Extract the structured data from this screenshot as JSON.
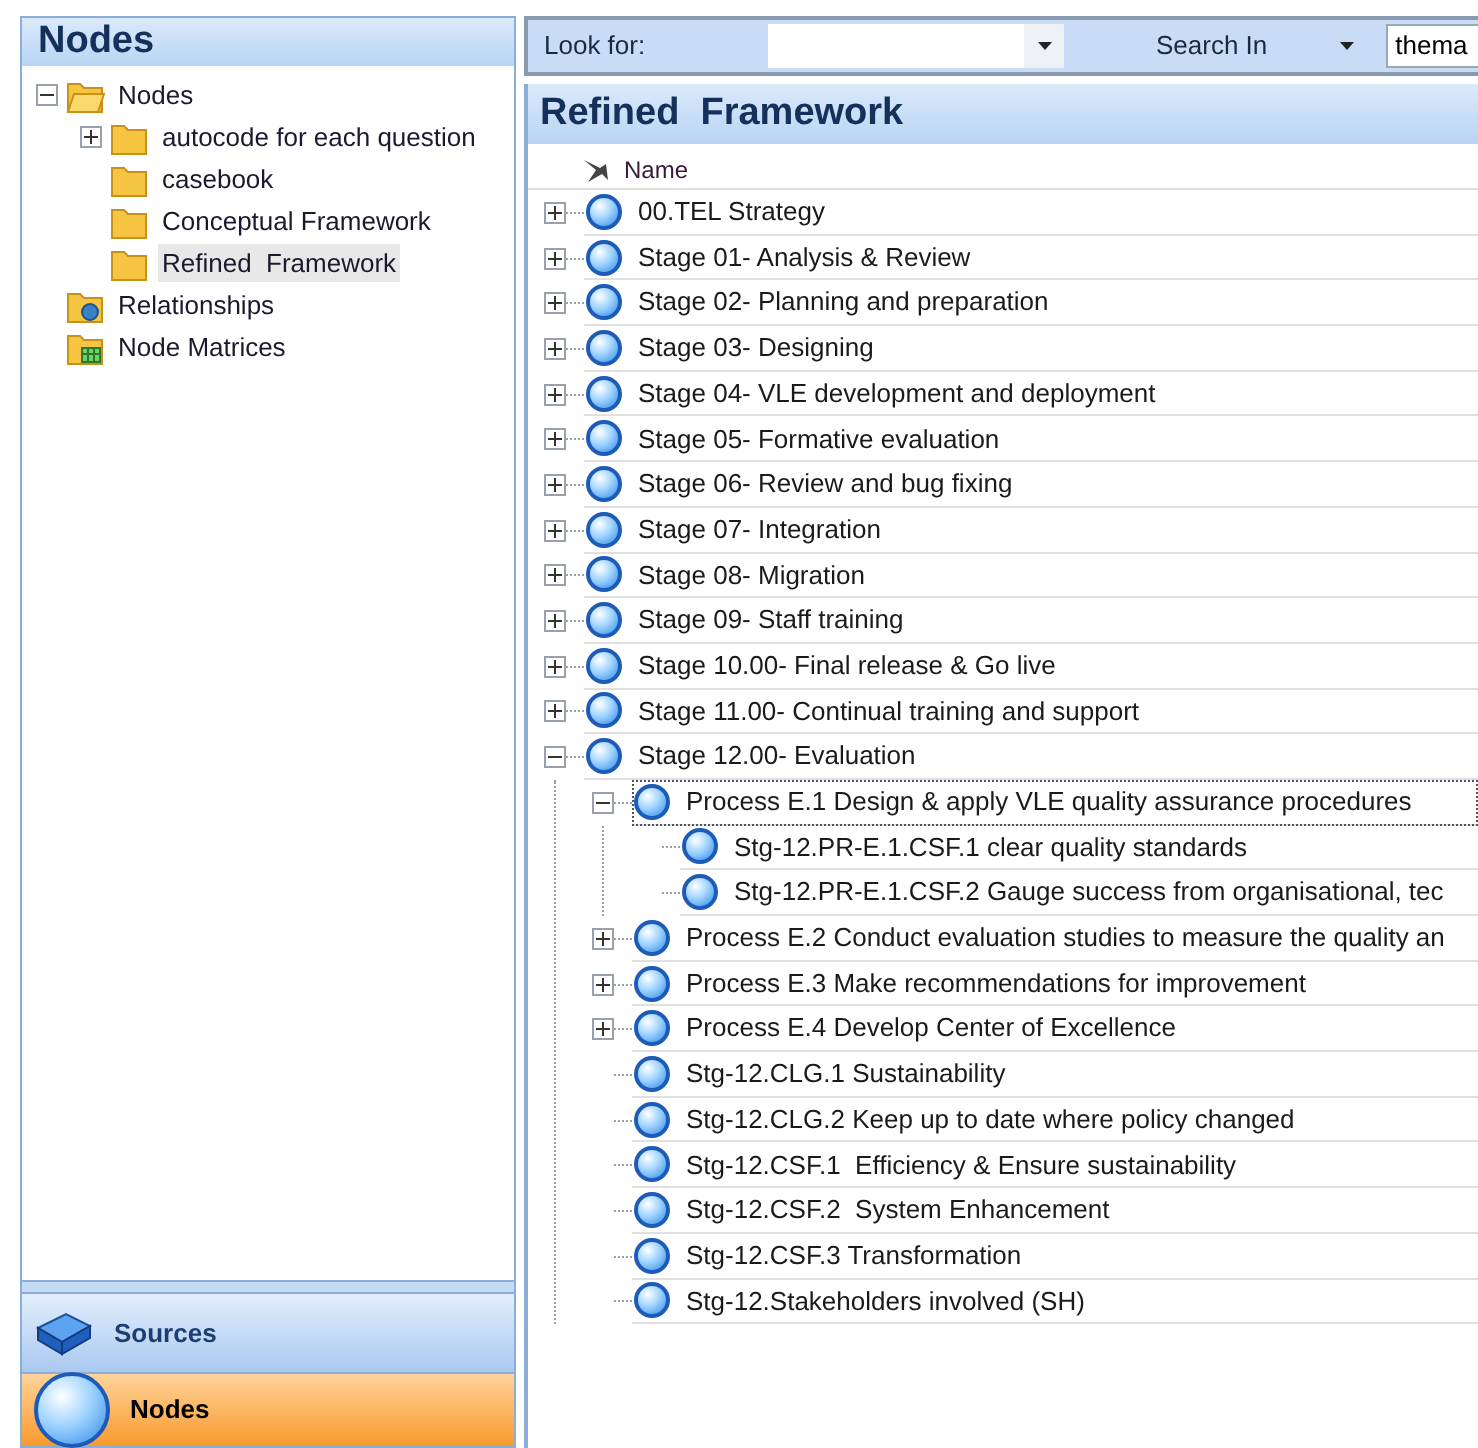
{
  "sidebar": {
    "title": "Nodes",
    "tree": [
      {
        "label": "Nodes",
        "kind": "open-folder",
        "expanded": true,
        "selected": false,
        "children": [
          {
            "label": "autocode for each question",
            "kind": "folder",
            "expanded": false,
            "selected": false
          },
          {
            "label": "casebook",
            "kind": "folder",
            "selected": false
          },
          {
            "label": "Conceptual Framework",
            "kind": "folder",
            "selected": false
          },
          {
            "label": "Refined  Framework",
            "kind": "folder",
            "selected": true
          }
        ]
      },
      {
        "label": "Relationships",
        "kind": "relationships",
        "selected": false
      },
      {
        "label": "Node Matrices",
        "kind": "matrices",
        "selected": false
      }
    ]
  },
  "nav_buttons": [
    {
      "label": "Sources",
      "kind": "sources",
      "selected": false
    },
    {
      "label": "Nodes",
      "kind": "nodes",
      "selected": true
    }
  ],
  "toolbar": {
    "look_for_label": "Look for:",
    "search_in_label": "Search In",
    "search_in_value": "thema"
  },
  "list": {
    "title": "Refined  Framework",
    "column": "Name",
    "rows": [
      {
        "label": "00.TEL Strategy",
        "expanded": false,
        "selected": false
      },
      {
        "label": "Stage 01- Analysis & Review",
        "expanded": false,
        "selected": false
      },
      {
        "label": "Stage 02- Planning and preparation",
        "expanded": false,
        "selected": false
      },
      {
        "label": "Stage 03- Designing",
        "expanded": false,
        "selected": false
      },
      {
        "label": "Stage 04- VLE development and deployment",
        "expanded": false,
        "selected": false
      },
      {
        "label": "Stage 05- Formative evaluation",
        "expanded": false,
        "selected": false
      },
      {
        "label": "Stage 06- Review and bug fixing",
        "expanded": false,
        "selected": false
      },
      {
        "label": "Stage 07- Integration",
        "expanded": false,
        "selected": false
      },
      {
        "label": "Stage 08- Migration",
        "expanded": false,
        "selected": false
      },
      {
        "label": "Stage 09- Staff training",
        "expanded": false,
        "selected": false
      },
      {
        "label": "Stage 10.00- Final release & Go live",
        "expanded": false,
        "selected": false
      },
      {
        "label": "Stage 11.00- Continual training and support",
        "expanded": false,
        "selected": false
      },
      {
        "label": "Stage 12.00- Evaluation",
        "expanded": true,
        "selected": false,
        "children": [
          {
            "label": "Process E.1 Design & apply VLE quality assurance procedures",
            "expanded": true,
            "selected": true,
            "children": [
              {
                "label": "Stg-12.PR-E.1.CSF.1 clear quality standards",
                "selected": false
              },
              {
                "label": "Stg-12.PR-E.1.CSF.2 Gauge success from organisational, tec",
                "selected": false
              }
            ]
          },
          {
            "label": "Process E.2 Conduct evaluation studies to measure the quality an",
            "expanded": false,
            "selected": false
          },
          {
            "label": "Process E.3 Make recommendations for improvement",
            "expanded": false,
            "selected": false
          },
          {
            "label": "Process E.4 Develop Center of Excellence",
            "expanded": false,
            "selected": false
          },
          {
            "label": "Stg-12.CLG.1 Sustainability",
            "selected": false
          },
          {
            "label": "Stg-12.CLG.2 Keep up to date where policy changed",
            "selected": false
          },
          {
            "label": "Stg-12.CSF.1  Efficiency & Ensure sustainability",
            "selected": false
          },
          {
            "label": "Stg-12.CSF.2  System Enhancement",
            "selected": false
          },
          {
            "label": "Stg-12.CSF.3 Transformation",
            "selected": false
          },
          {
            "label": "Stg-12.Stakeholders involved (SH)",
            "selected": false
          }
        ]
      }
    ]
  }
}
